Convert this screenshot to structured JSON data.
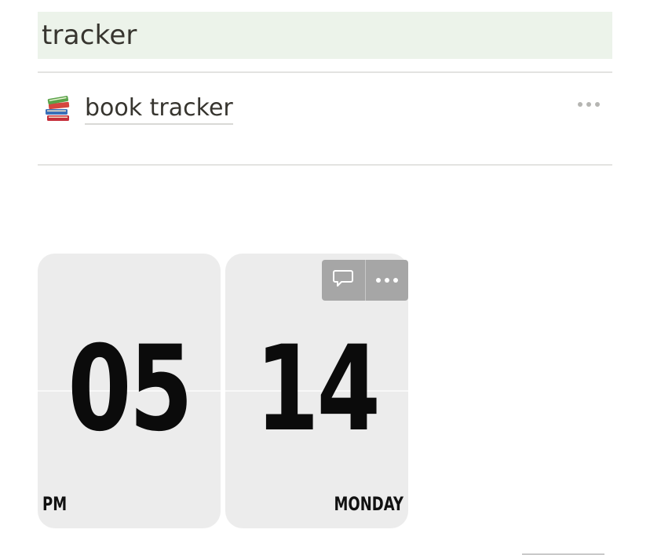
{
  "section": {
    "title": "tracker"
  },
  "page_link": {
    "icon": "books-icon",
    "label": "book tracker",
    "more_icon": "more-horizontal-icon"
  },
  "clock": {
    "hour": "05",
    "period": "PM",
    "day": "14",
    "weekday": "MONDAY"
  },
  "card_toolbar": {
    "icons": [
      "comment-icon",
      "more-horizontal-icon"
    ]
  },
  "colors": {
    "header_background": "#ecf3ea",
    "text": "#37352f",
    "card_background": "#ececec",
    "toolbar_background": "#a6a6a6"
  }
}
